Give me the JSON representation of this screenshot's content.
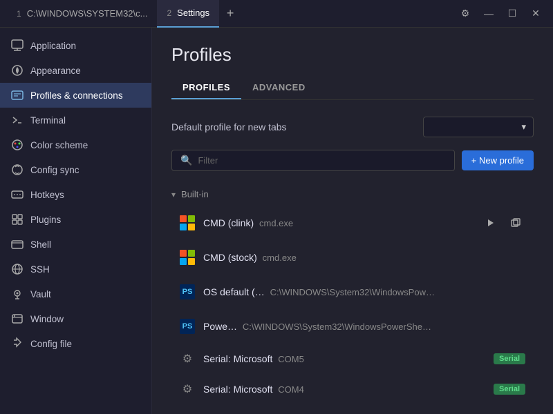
{
  "titlebar": {
    "tabs": [
      {
        "id": "tab1",
        "num": "1",
        "label": "C:\\WINDOWS\\SYSTEM32\\c...",
        "active": false
      },
      {
        "id": "tab2",
        "num": "2",
        "label": "Settings",
        "active": true
      }
    ],
    "add_tab_label": "+",
    "gear_btn": "⚙",
    "minimize_btn": "—",
    "maximize_btn": "☐",
    "close_btn": "✕"
  },
  "sidebar": {
    "items": [
      {
        "id": "application",
        "icon": "🖥",
        "label": "Application"
      },
      {
        "id": "appearance",
        "icon": "🎨",
        "label": "Appearance"
      },
      {
        "id": "profiles-connections",
        "icon": "📋",
        "label": "Profiles & connections",
        "active": true
      },
      {
        "id": "terminal",
        "icon": "⌨",
        "label": "Terminal"
      },
      {
        "id": "color-scheme",
        "icon": "🎨",
        "label": "Color scheme"
      },
      {
        "id": "config-sync",
        "icon": "☁",
        "label": "Config sync"
      },
      {
        "id": "hotkeys",
        "icon": "⌨",
        "label": "Hotkeys"
      },
      {
        "id": "plugins",
        "icon": "🧩",
        "label": "Plugins"
      },
      {
        "id": "shell",
        "icon": "⬛",
        "label": "Shell"
      },
      {
        "id": "ssh",
        "icon": "🌐",
        "label": "SSH"
      },
      {
        "id": "vault",
        "icon": "🔑",
        "label": "Vault"
      },
      {
        "id": "window",
        "icon": "🪟",
        "label": "Window"
      },
      {
        "id": "config-file",
        "icon": "◇",
        "label": "Config file"
      }
    ]
  },
  "content": {
    "title": "Profiles",
    "tabs": [
      {
        "id": "profiles",
        "label": "PROFILES",
        "active": true
      },
      {
        "id": "advanced",
        "label": "ADVANCED",
        "active": false
      }
    ],
    "default_profile_label": "Default profile for new tabs",
    "dropdown_placeholder": "",
    "filter_placeholder": "Filter",
    "new_profile_btn": "+ New profile",
    "builtin_section": "Built-in",
    "profiles": [
      {
        "id": "cmd-clink",
        "type": "windows",
        "name": "CMD (clink)",
        "subtitle": "cmd.exe",
        "badge": "",
        "show_actions": true
      },
      {
        "id": "cmd-stock",
        "type": "windows",
        "name": "CMD (stock)",
        "subtitle": "cmd.exe",
        "badge": "",
        "show_actions": false
      },
      {
        "id": "os-default",
        "type": "ps",
        "name": "OS default (…",
        "subtitle": "C:\\WINDOWS\\System32\\WindowsPow…",
        "badge": "",
        "show_actions": false
      },
      {
        "id": "powershell",
        "type": "ps",
        "name": "Powe…",
        "subtitle": "C:\\WINDOWS\\System32\\WindowsPowerShe…",
        "badge": "",
        "show_actions": false
      },
      {
        "id": "serial-com5",
        "type": "gear",
        "name": "Serial: Microsoft",
        "subtitle": "COM5",
        "badge": "Serial",
        "show_actions": false
      },
      {
        "id": "serial-com4",
        "type": "gear",
        "name": "Serial: Microsoft",
        "subtitle": "COM4",
        "badge": "Serial",
        "show_actions": false
      }
    ]
  }
}
